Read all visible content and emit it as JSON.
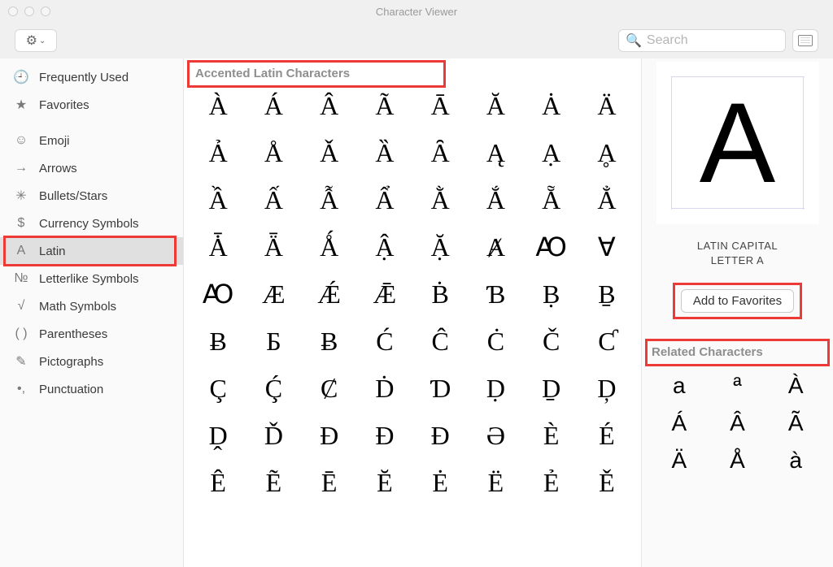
{
  "window": {
    "title": "Character Viewer"
  },
  "search": {
    "placeholder": "Search"
  },
  "sidebar": {
    "items": [
      {
        "icon": "🕘",
        "label": "Frequently Used",
        "selected": false,
        "gapAfter": false
      },
      {
        "icon": "★",
        "label": "Favorites",
        "selected": false,
        "gapAfter": true
      },
      {
        "icon": "☺",
        "label": "Emoji",
        "selected": false,
        "gapAfter": false
      },
      {
        "icon": "→",
        "label": "Arrows",
        "selected": false,
        "gapAfter": false
      },
      {
        "icon": "✳︎",
        "label": "Bullets/Stars",
        "selected": false,
        "gapAfter": false
      },
      {
        "icon": "$",
        "label": "Currency Symbols",
        "selected": false,
        "gapAfter": false
      },
      {
        "icon": "A",
        "label": "Latin",
        "selected": true,
        "gapAfter": false,
        "highlighted": true
      },
      {
        "icon": "№",
        "label": "Letterlike Symbols",
        "selected": false,
        "gapAfter": false
      },
      {
        "icon": "√",
        "label": "Math Symbols",
        "selected": false,
        "gapAfter": false
      },
      {
        "icon": "( )",
        "label": "Parentheses",
        "selected": false,
        "gapAfter": false
      },
      {
        "icon": "✎",
        "label": "Pictographs",
        "selected": false,
        "gapAfter": false
      },
      {
        "icon": "•,",
        "label": "Punctuation",
        "selected": false,
        "gapAfter": false
      }
    ]
  },
  "main": {
    "section_title": "Accented Latin Characters",
    "chars": [
      "À",
      "Á",
      "Â",
      "Ã",
      "Ā",
      "Ă",
      "Ȧ",
      "Ä",
      "Ả",
      "Å",
      "Ǎ",
      "Ȁ",
      "Ȃ",
      "Ą",
      "Ạ",
      "Ḁ",
      "Ầ",
      "Ấ",
      "Ẫ",
      "Ẩ",
      "Ằ",
      "Ắ",
      "Ẵ",
      "Ẳ",
      "Ǡ",
      "Ǟ",
      "Ǻ",
      "Ậ",
      "Ặ",
      "Ⱥ",
      "Ꜵ",
      "Ɐ",
      "Ꜵ",
      "Æ",
      "Ǽ",
      "Ǣ",
      "Ḃ",
      "Ɓ",
      "Ḅ",
      "Ḇ",
      "Ƀ",
      "Ƃ",
      "Ƀ",
      "Ć",
      "Ĉ",
      "Ċ",
      "Č",
      "Ƈ",
      "Ç",
      "Ḉ",
      "Ȼ",
      "Ḋ",
      "Ɗ",
      "Ḍ",
      "Ḏ",
      "Ḑ",
      "Ḓ",
      "Ď",
      "Đ",
      "Ð",
      "Ɖ",
      "Ə",
      "È",
      "É",
      "Ê",
      "Ẽ",
      "Ē",
      "Ĕ",
      "Ė",
      "Ë",
      "Ẻ",
      "Ě"
    ]
  },
  "detail": {
    "preview_char": "A",
    "char_name_line1": "LATIN CAPITAL",
    "char_name_line2": "LETTER A",
    "add_fav_label": "Add to Favorites",
    "related_title": "Related Characters",
    "related": [
      "a",
      "ª",
      "À",
      "Á",
      "Â",
      "Ã",
      "Ä",
      "Å",
      "à"
    ]
  }
}
